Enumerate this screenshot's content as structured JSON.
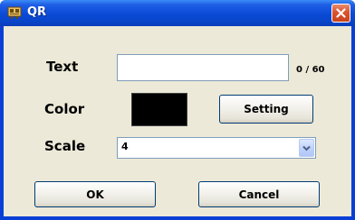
{
  "window": {
    "title": "QR",
    "close_icon": "close-icon",
    "app_icon": "qr-app-icon"
  },
  "form": {
    "text_label": "Text",
    "text_value": "",
    "counter": "0 / 60",
    "color_label": "Color",
    "color_value": "#000000",
    "setting_button": "Setting",
    "scale_label": "Scale",
    "scale_value": "4",
    "scale_arrow_icon": "chevron-down-icon"
  },
  "buttons": {
    "ok": "OK",
    "cancel": "Cancel"
  },
  "colors": {
    "titlebar": "#0a4ad6",
    "dialog_bg": "#ece9d8",
    "close_button": "#d9532f"
  }
}
